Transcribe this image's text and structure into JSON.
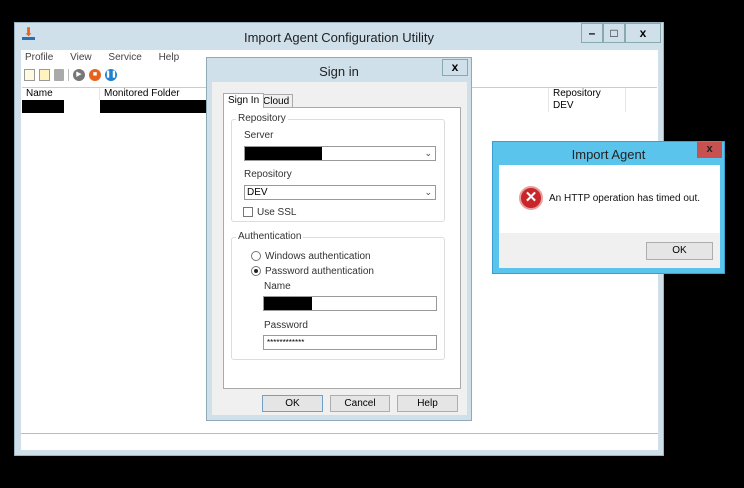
{
  "main_window": {
    "title": "Import Agent Configuration Utility",
    "minimize": "–",
    "maximize": "□",
    "close": "x",
    "menu": [
      "Profile",
      "View",
      "Service",
      "Help"
    ],
    "toolbar": [
      "new-profile-icon",
      "edit-profile-icon",
      "delete-icon",
      "start-icon",
      "stop-icon",
      "pause-icon"
    ],
    "grid": {
      "columns": [
        "Name",
        "Monitored Folder",
        "Repository"
      ],
      "rows": [
        {
          "repository": "DEV"
        }
      ]
    }
  },
  "signin": {
    "title": "Sign in",
    "close": "x",
    "tabs": [
      "Sign In",
      "Cloud"
    ],
    "repository_group": "Repository",
    "server_label": "Server",
    "repository_label": "Repository",
    "repository_value": "DEV",
    "use_ssl": "Use SSL",
    "auth_group": "Authentication",
    "windows_auth": "Windows authentication",
    "password_auth": "Password authentication",
    "name_label": "Name",
    "password_label": "Password",
    "password_value": "************",
    "ok": "OK",
    "cancel": "Cancel",
    "help": "Help"
  },
  "alert": {
    "title": "Import Agent",
    "close": "x",
    "message": "An HTTP operation has timed out.",
    "ok": "OK",
    "accent": "#5bc4ec"
  }
}
